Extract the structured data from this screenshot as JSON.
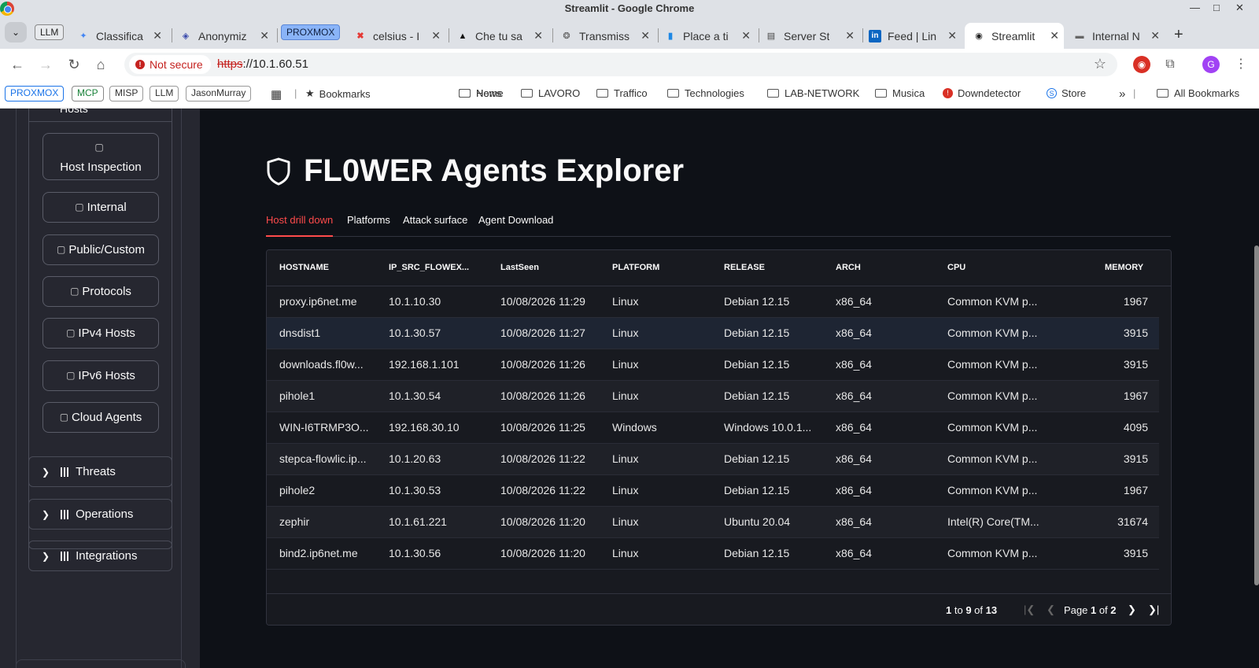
{
  "window": {
    "title": "Streamlit - Google Chrome"
  },
  "tabs": [
    {
      "pill": "LLM"
    },
    {
      "label": "Classifica",
      "icon": "gemini-icon"
    },
    {
      "label": "Anonymiz",
      "icon": "anonymizer-icon"
    },
    {
      "pill": "PROXMOX"
    },
    {
      "label": "celsius - I",
      "icon": "x-icon"
    },
    {
      "label": "Che tu sa",
      "icon": "app-icon"
    },
    {
      "label": "Transmiss",
      "icon": "transmission-icon"
    },
    {
      "label": "Place a ti",
      "icon": "chart-icon"
    },
    {
      "label": "Server St",
      "icon": "server-icon"
    },
    {
      "label": "Feed | Lin",
      "icon": "linkedin-icon"
    },
    {
      "label": "Streamlit",
      "icon": "streamlit-icon",
      "active": true
    },
    {
      "label": "Internal N",
      "icon": "doc-icon"
    }
  ],
  "toolbar": {
    "not_secure": "Not secure",
    "url_scheme": "https",
    "url_rest": "://10.1.60.51",
    "profile_initial": "G"
  },
  "bookmarks": {
    "pills": [
      "PROXMOX",
      "MCP",
      "MISP",
      "LLM",
      "JasonMurray"
    ],
    "items": [
      "Bookmarks",
      "Home",
      "News",
      "LAVORO",
      "Traffico",
      "Technologies",
      "LAB-NETWORK",
      "Musica",
      "Downdetector",
      "Store"
    ],
    "all": "All Bookmarks"
  },
  "sidebar": {
    "hosts_header": "Hosts",
    "buttons": [
      "Host Inspection",
      "Internal",
      "Public/Custom",
      "Protocols",
      "IPv4 Hosts",
      "IPv6 Hosts",
      "Cloud Agents"
    ],
    "expanders": [
      "Threats",
      "Operations",
      "Integrations"
    ]
  },
  "main": {
    "title": "FL0WER Agents Explorer",
    "tabs": [
      "Host drill down",
      "Platforms",
      "Attack surface",
      "Agent Download"
    ],
    "active_tab": 0
  },
  "grid": {
    "columns": [
      "HOSTNAME",
      "IP_SRC_FLOWEX...",
      "LastSeen",
      "PLATFORM",
      "RELEASE",
      "ARCH",
      "CPU",
      "MEMORY"
    ],
    "rows": [
      [
        "proxy.ip6net.me",
        "10.1.10.30",
        "10/08/2026 11:29",
        "Linux",
        "Debian 12.15",
        "x86_64",
        "Common KVM p...",
        "1967"
      ],
      [
        "dnsdist1",
        "10.1.30.57",
        "10/08/2026 11:27",
        "Linux",
        "Debian 12.15",
        "x86_64",
        "Common KVM p...",
        "3915"
      ],
      [
        "downloads.fl0w...",
        "192.168.1.101",
        "10/08/2026 11:26",
        "Linux",
        "Debian 12.15",
        "x86_64",
        "Common KVM p...",
        "3915"
      ],
      [
        "pihole1",
        "10.1.30.54",
        "10/08/2026 11:26",
        "Linux",
        "Debian 12.15",
        "x86_64",
        "Common KVM p...",
        "1967"
      ],
      [
        "WIN-I6TRMP3O...",
        "192.168.30.10",
        "10/08/2026 11:25",
        "Windows",
        "Windows 10.0.1...",
        "x86_64",
        "Common KVM p...",
        "4095"
      ],
      [
        "stepca-flowlic.ip...",
        "10.1.20.63",
        "10/08/2026 11:22",
        "Linux",
        "Debian 12.15",
        "x86_64",
        "Common KVM p...",
        "3915"
      ],
      [
        "pihole2",
        "10.1.30.53",
        "10/08/2026 11:22",
        "Linux",
        "Debian 12.15",
        "x86_64",
        "Common KVM p...",
        "1967"
      ],
      [
        "zephir",
        "10.1.61.221",
        "10/08/2026 11:20",
        "Linux",
        "Ubuntu 20.04",
        "x86_64",
        "Intel(R) Core(TM...",
        "31674"
      ],
      [
        "bind2.ip6net.me",
        "10.1.30.56",
        "10/08/2026 11:20",
        "Linux",
        "Debian 12.15",
        "x86_64",
        "Common KVM p...",
        "3915"
      ]
    ],
    "footer": {
      "range_from": "1",
      "range_to": "9",
      "range_total": "13",
      "page": "1",
      "page_total": "2"
    }
  }
}
